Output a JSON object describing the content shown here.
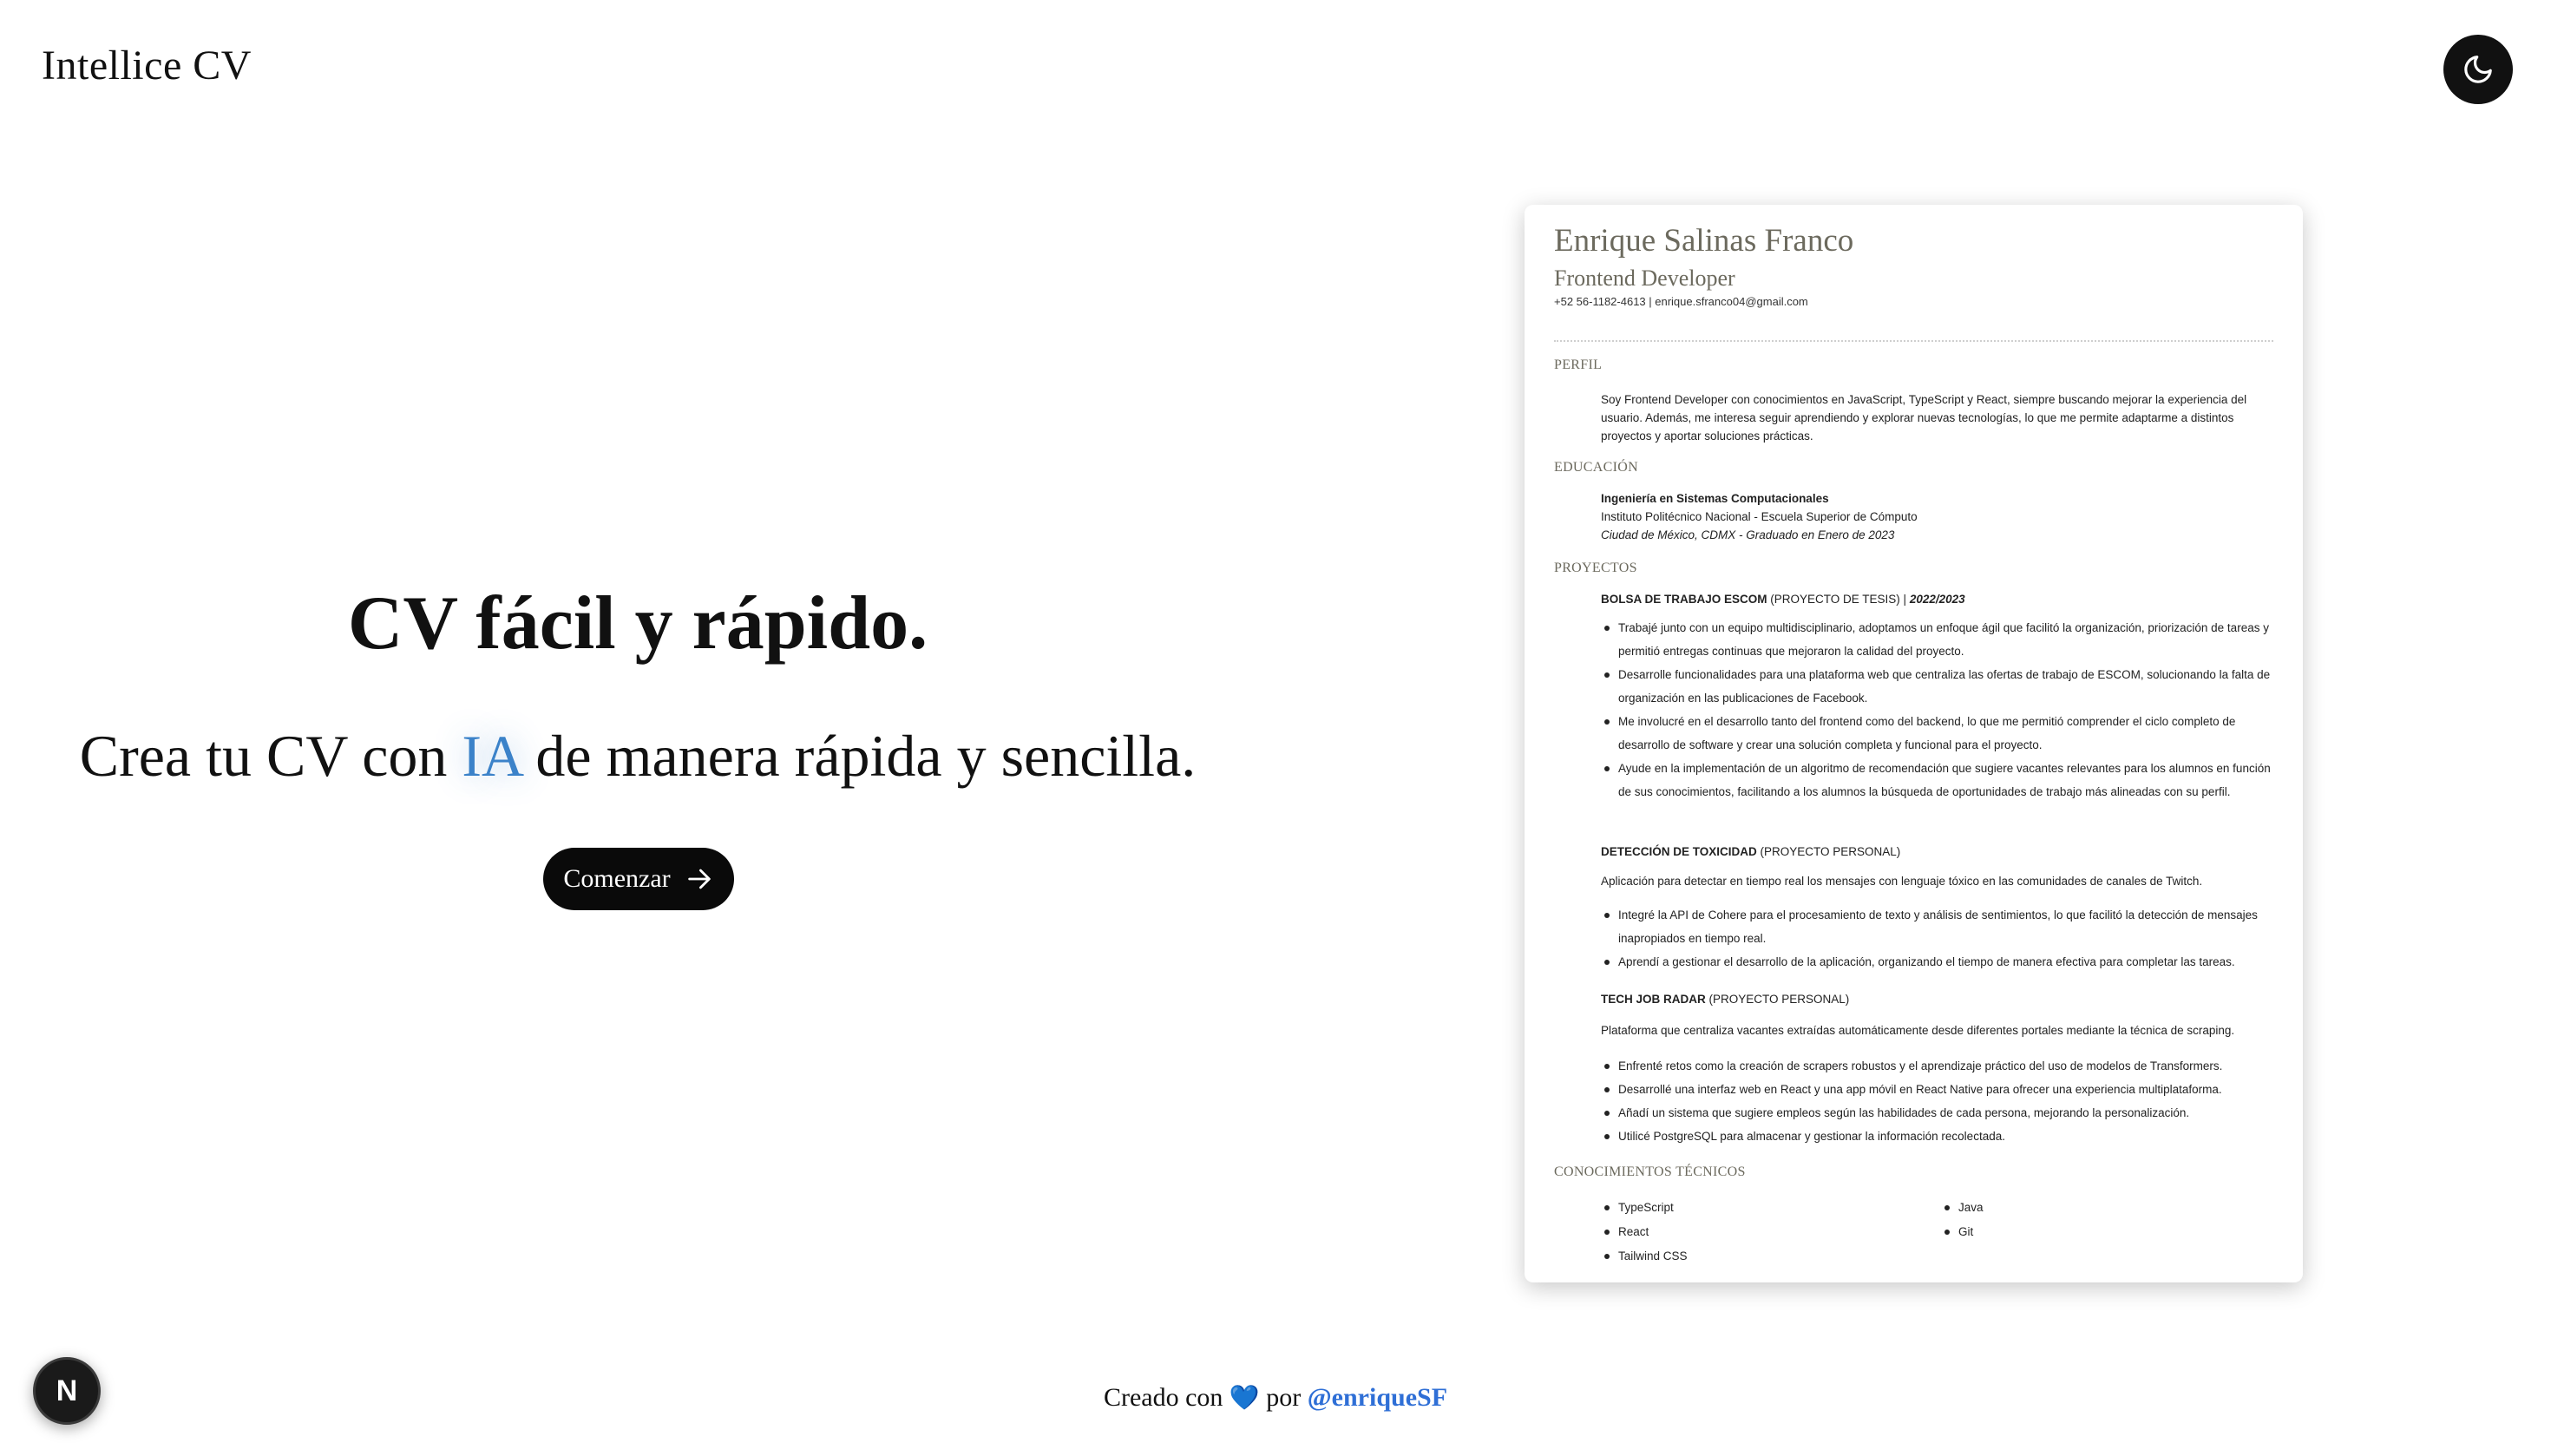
{
  "brand": "Intellice CV",
  "theme_toggle": {
    "icon": "moon-icon"
  },
  "hero": {
    "title": "CV fácil y rápido.",
    "subtitle_before": "Crea tu CV con ",
    "subtitle_highlight": "IA",
    "subtitle_after": " de manera rápida y sencilla.",
    "cta_label": "Comenzar",
    "cta_icon": "arrow-right-icon",
    "highlight_color": "#3b82c9"
  },
  "cv": {
    "name": "Enrique Salinas Franco",
    "role": "Frontend Developer",
    "contact": "+52 56-1182-4613 |  enrique.sfranco04@gmail.com",
    "sections": {
      "perfil": "PERFIL",
      "educacion": "EDUCACIÓN",
      "proyectos": "PROYECTOS",
      "conocimientos": "CONOCIMIENTOS TÉCNICOS"
    },
    "perfil_text": "Soy Frontend Developer con conocimientos en JavaScript, TypeScript y React, siempre buscando mejorar la experiencia del usuario. Además, me interesa seguir aprendiendo y explorar  nuevas tecnologías, lo que me permite adaptarme a distintos proyectos y aportar soluciones prácticas.",
    "education": {
      "degree": "Ingeniería en Sistemas Computacionales",
      "school": "Instituto Politécnico Nacional - Escuela Superior de Cómputo",
      "details": "Ciudad de México, CDMX - Graduado en Enero de 2023"
    },
    "projects": [
      {
        "title": "BOLSA DE TRABAJO ESCOM",
        "tag": " (PROYECTO DE TESIS) | ",
        "date": "2022/2023",
        "description": "",
        "bullets": [
          "Trabajé junto con un equipo multidisciplinario, adoptamos un enfoque ágil que facilitó la organización, priorización de tareas y permitió entregas continuas que mejoraron la calidad del proyecto.",
          "Desarrolle funcionalidades para una plataforma web que centraliza las ofertas de trabajo de ESCOM, solucionando la falta de organización en las publicaciones de Facebook.",
          "Me involucré en el desarrollo tanto del frontend como del backend, lo que me permitió comprender el ciclo completo de desarrollo de software y crear una solución completa y funcional para el proyecto.",
          "Ayude en la implementación de un algoritmo de recomendación que sugiere vacantes relevantes para los alumnos en función de sus conocimientos, facilitando a los alumnos la búsqueda de oportunidades de trabajo más alineadas con su perfil."
        ]
      },
      {
        "title": "DETECCIÓN DE TOXICIDAD",
        "tag": " (PROYECTO PERSONAL)",
        "date": "",
        "description": "Aplicación para detectar en tiempo real los mensajes con lenguaje tóxico en las comunidades de canales de Twitch.",
        "bullets": [
          "Integré la API de Cohere para el procesamiento de texto y análisis de sentimientos, lo que facilitó la detección de mensajes inapropiados en tiempo real.",
          "Aprendí a gestionar el desarrollo de la aplicación, organizando el tiempo de manera efectiva para completar las tareas."
        ]
      },
      {
        "title": "TECH JOB RADAR",
        "tag": " (PROYECTO PERSONAL)",
        "date": "",
        "description": "Plataforma que centraliza vacantes extraídas automáticamente desde diferentes portales mediante la técnica de scraping.",
        "bullets": [
          "Enfrenté retos como la creación de scrapers robustos y el aprendizaje práctico del uso de modelos de Transformers.",
          "Desarrollé una interfaz web en React y una app móvil en React Native para ofrecer una experiencia multiplataforma.",
          "Añadí un sistema que sugiere empleos según las habilidades de cada persona, mejorando la personalización.",
          "Utilicé PostgreSQL para almacenar y gestionar la información recolectada."
        ]
      }
    ],
    "skills_col1": [
      "TypeScript",
      "React",
      "Tailwind CSS"
    ],
    "skills_col2": [
      "Java",
      "Git"
    ]
  },
  "next_badge": "N",
  "footer": {
    "prefix": "Creado con ",
    "heart": "💙",
    "middle": " por ",
    "handle": "@enriqueSF"
  }
}
